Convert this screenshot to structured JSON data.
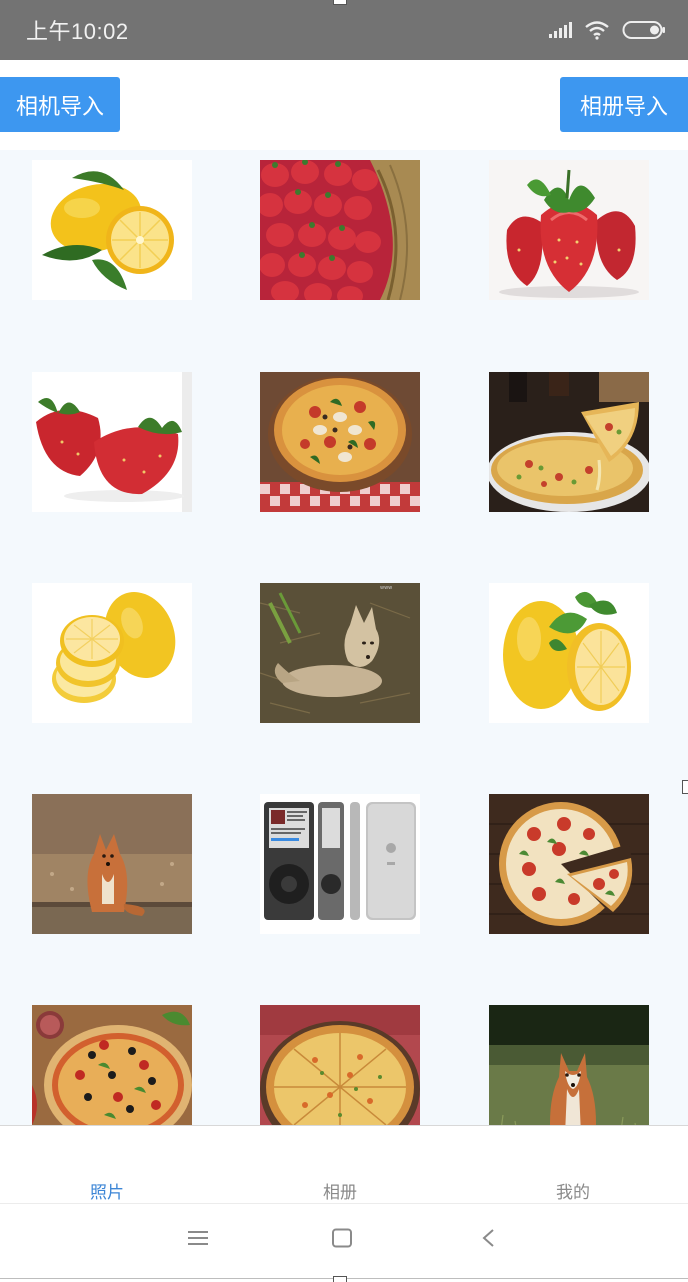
{
  "status_bar": {
    "time": "上午10:02"
  },
  "header": {
    "camera_button": "相机导入",
    "album_button": "相册导入"
  },
  "grid": {
    "photos": [
      {
        "subject": "lemon"
      },
      {
        "subject": "strawberry-basket"
      },
      {
        "subject": "strawberries"
      },
      {
        "subject": "strawberries-pair"
      },
      {
        "subject": "pizza-mushroom"
      },
      {
        "subject": "pizza-slice"
      },
      {
        "subject": "lemon-slices"
      },
      {
        "subject": "fox-resting"
      },
      {
        "subject": "lemon-leaf"
      },
      {
        "subject": "fox-sitting"
      },
      {
        "subject": "ipod"
      },
      {
        "subject": "pizza-tomato"
      },
      {
        "subject": "pizza-salami"
      },
      {
        "subject": "pizza-cheese"
      },
      {
        "subject": "fox-grass"
      }
    ]
  },
  "tabbar": {
    "tabs": [
      {
        "label": "照片"
      },
      {
        "label": "相册"
      },
      {
        "label": "我的"
      }
    ],
    "active_color": "#3d86d6"
  },
  "colors": {
    "accent": "#3d97f0",
    "status_bar": "#737373",
    "grid_bg": "#f4f9fd"
  },
  "navbar": {
    "icons": [
      "menu-icon",
      "home-icon",
      "back-icon"
    ]
  }
}
